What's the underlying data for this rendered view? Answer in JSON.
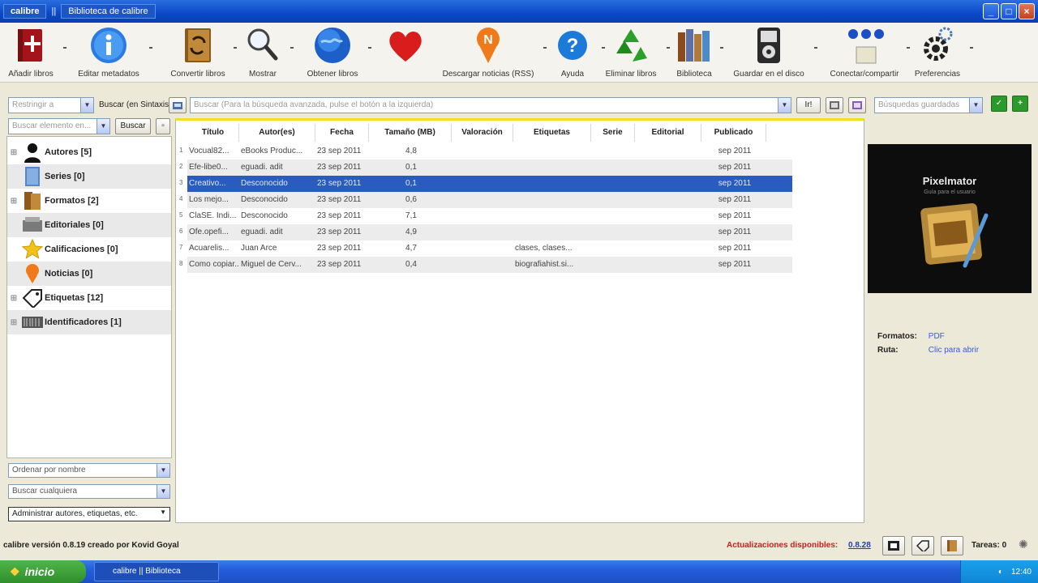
{
  "window": {
    "app_title": "calibre",
    "separator": "||",
    "library_title": "Biblioteca de calibre"
  },
  "toolbar": {
    "items": [
      {
        "label": "Añadir libros",
        "icon": "add-book-icon"
      },
      {
        "label": "Editar metadatos",
        "icon": "info-icon"
      },
      {
        "label": "Convertir libros",
        "icon": "convert-icon"
      },
      {
        "label": "Mostrar",
        "icon": "magnifier-icon"
      },
      {
        "label": "Obtener libros",
        "icon": "globe-icon"
      },
      {
        "label": "",
        "icon": "heart-icon"
      },
      {
        "label": "Descargar noticias (RSS)",
        "icon": "news-icon"
      },
      {
        "label": "Ayuda",
        "icon": "help-icon"
      },
      {
        "label": "Eliminar libros",
        "icon": "recycle-icon"
      },
      {
        "label": "Biblioteca",
        "icon": "library-icon"
      },
      {
        "label": "Guardar en el disco",
        "icon": "device-icon"
      },
      {
        "label": "Conectar/compartir",
        "icon": "connect-icon"
      },
      {
        "label": "Preferencias",
        "icon": "gear-icon"
      }
    ]
  },
  "search": {
    "restrict_placeholder": "Restringir a",
    "label": "Buscar (en Sintaxis):",
    "main_placeholder": "Buscar (Para la búsqueda avanzada, pulse el botón a la izquierda)",
    "go_label": "Ir!",
    "saved_placeholder": "Búsquedas guardadas"
  },
  "left": {
    "find_placeholder": "Buscar elemento en...",
    "find_button": "Buscar",
    "tree": [
      {
        "label": "Autores [5]",
        "icon": "person-icon",
        "expand": true
      },
      {
        "label": "Series [0]",
        "icon": "series-icon",
        "expand": false
      },
      {
        "label": "Formatos [2]",
        "icon": "formats-icon",
        "expand": true
      },
      {
        "label": "Editoriales [0]",
        "icon": "publisher-icon",
        "expand": false
      },
      {
        "label": "Calificaciones [0]",
        "icon": "star-icon",
        "expand": false
      },
      {
        "label": "Noticias [0]",
        "icon": "news-icon",
        "expand": false
      },
      {
        "label": "Etiquetas [12]",
        "icon": "tag-icon",
        "expand": true
      },
      {
        "label": "Identificadores [1]",
        "icon": "barcode-icon",
        "expand": true
      }
    ],
    "sort_by": "Ordenar por nombre",
    "match": "Buscar cualquiera",
    "manage": "Administrar autores, etiquetas, etc."
  },
  "list": {
    "columns": [
      "Título",
      "Autor(es)",
      "Fecha",
      "Tamaño (MB)",
      "Valoración",
      "Etiquetas",
      "Serie",
      "Editorial",
      "Publicado"
    ],
    "rows": [
      {
        "n": "1",
        "cells": [
          "Vocual82...",
          "eBooks Produc...",
          "23 sep 2011",
          "4,8",
          "",
          "",
          "",
          "",
          "sep 2011"
        ]
      },
      {
        "n": "2",
        "cells": [
          "Efe-libe0...",
          "eguadi. adit",
          "23 sep 2011",
          "0,1",
          "",
          "",
          "",
          "",
          "sep 2011"
        ]
      },
      {
        "n": "3",
        "cells": [
          "Creativo...",
          "Desconocido",
          "23 sep 2011",
          "0,1",
          "",
          "",
          "",
          "",
          "sep 2011"
        ]
      },
      {
        "n": "4",
        "cells": [
          "Los mejo...",
          "Desconocido",
          "23 sep 2011",
          "0,6",
          "",
          "",
          "",
          "",
          "sep 2011"
        ]
      },
      {
        "n": "5",
        "cells": [
          "ClaSE. Indi...",
          "Desconocido",
          "23 sep 2011",
          "7,1",
          "",
          "",
          "",
          "",
          "sep 2011"
        ]
      },
      {
        "n": "6",
        "cells": [
          "Ofe.opefi...",
          "eguadi. adit",
          "23 sep 2011",
          "4,9",
          "",
          "",
          "",
          "",
          "sep 2011"
        ]
      },
      {
        "n": "7",
        "cells": [
          "Acuarelis...",
          "Juan Arce",
          "23 sep 2011",
          "4,7",
          "",
          "clases, clases...",
          "",
          "",
          "sep 2011"
        ]
      },
      {
        "n": "8",
        "cells": [
          "Como copiar...",
          "Miguel de Cerv...",
          "23 sep 2011",
          "0,4",
          "",
          "biografiahist.si...",
          "",
          "",
          "sep 2011"
        ]
      }
    ],
    "selected_index": 2
  },
  "details": {
    "format_label": "Formatos:",
    "format_value": "PDF",
    "path_label": "Ruta:",
    "path_value": "Clic para abrir",
    "cover_title": "Pixelmator",
    "cover_subtitle": "Guía para el usuario"
  },
  "status": {
    "left": "calibre versión 0.8.19 creado por Kovid Goyal",
    "update": "Actualizaciones disponibles:",
    "update_link": "0.8.28",
    "jobs": "Tareas: 0"
  },
  "taskbar": {
    "start": "inicio",
    "item": "calibre || Biblioteca",
    "clock": "12:40"
  },
  "colors": {
    "accent_row": "#2a5cbf",
    "update_text": "#d61a1a",
    "link": "#3a5bd8"
  }
}
